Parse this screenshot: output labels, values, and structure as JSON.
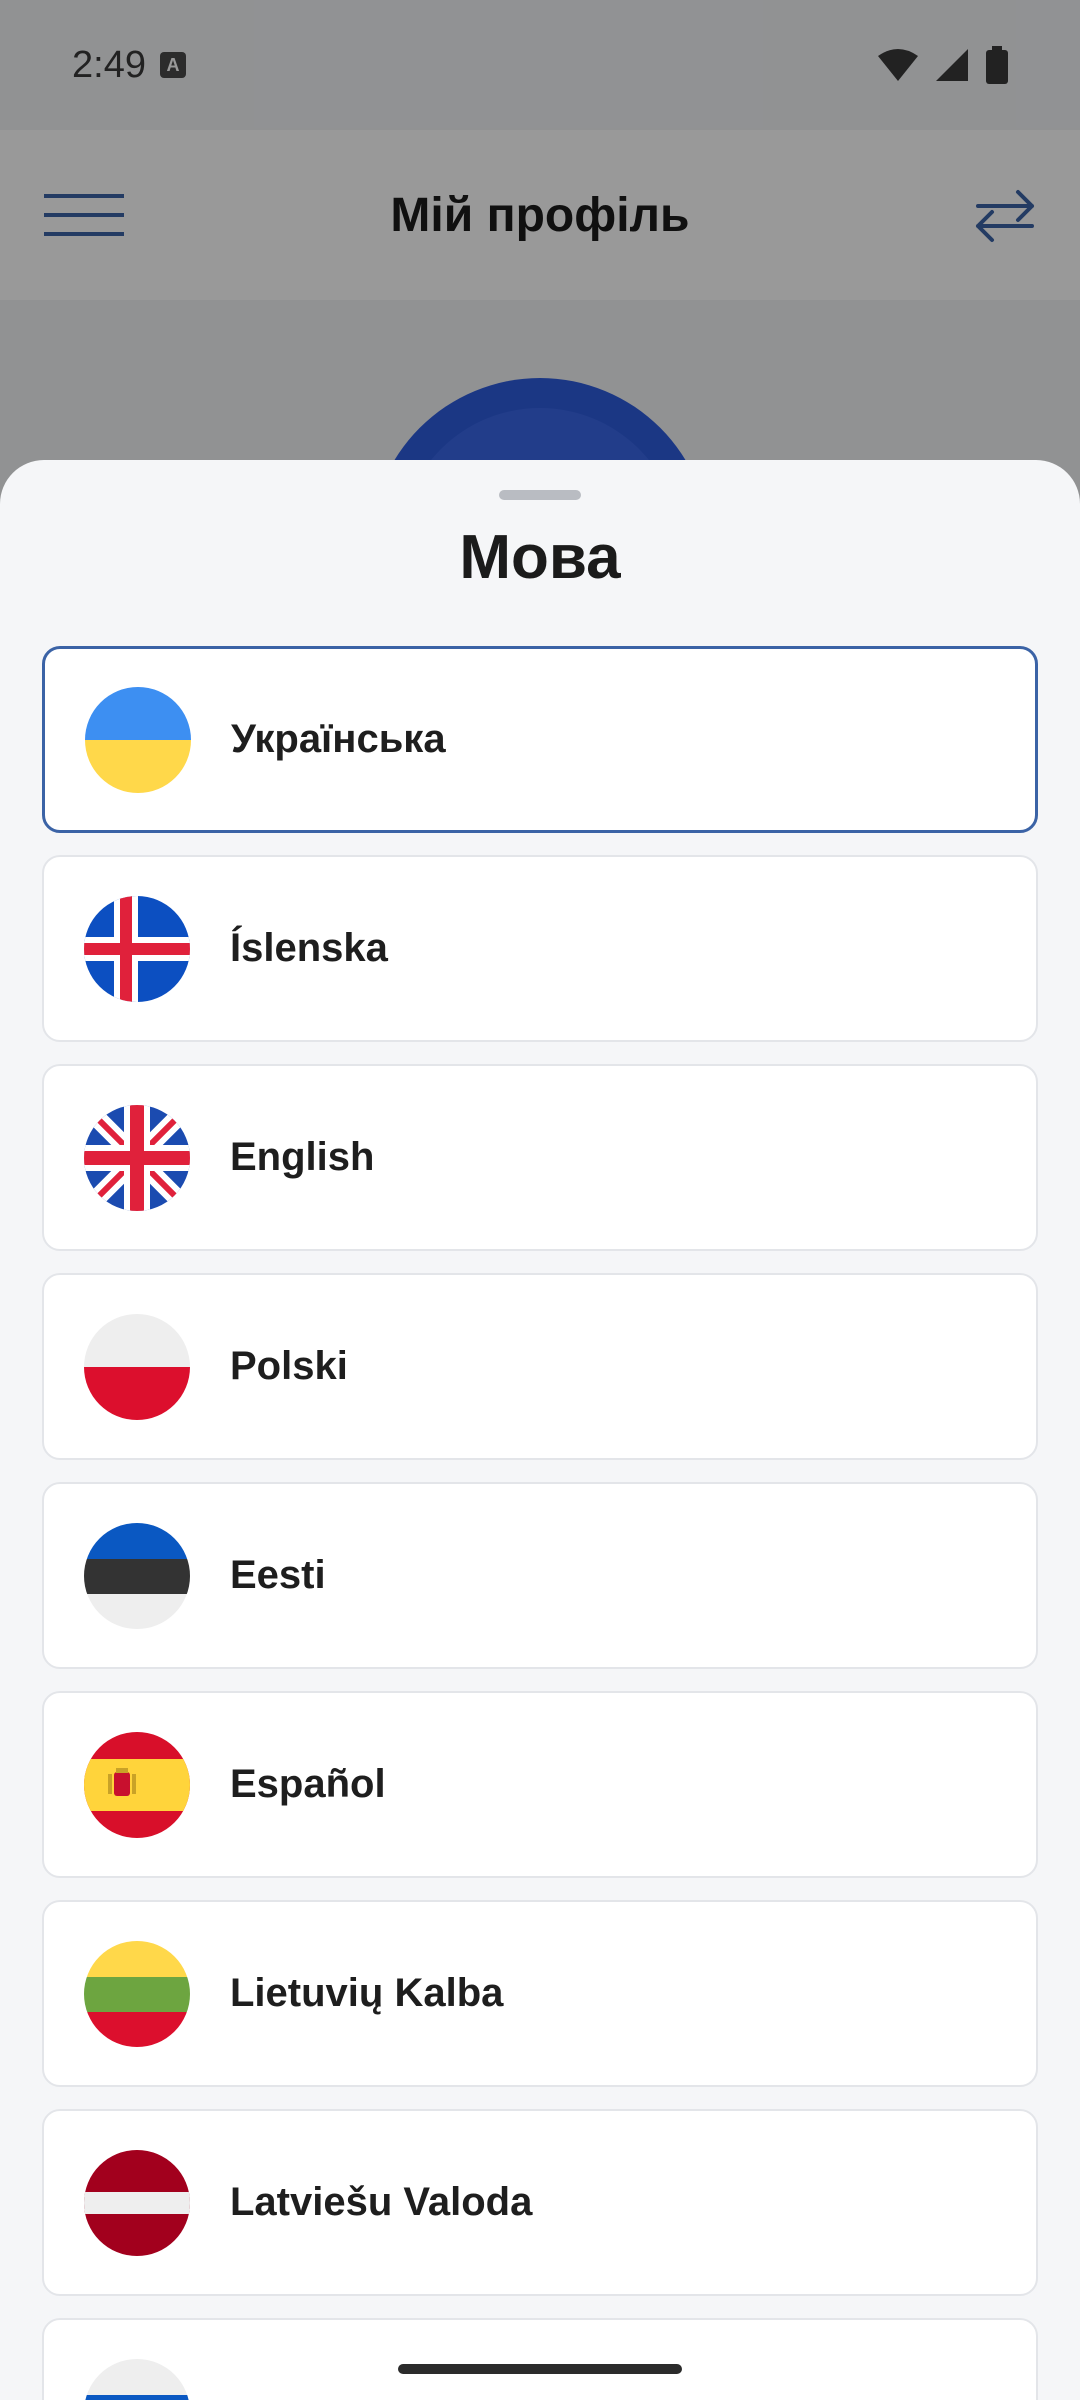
{
  "status_bar": {
    "time": "2:49",
    "badge": "A"
  },
  "app_bar": {
    "title": "Мій профіль"
  },
  "sheet": {
    "title": "Мова",
    "languages": [
      {
        "label": "Українська",
        "flag": "ukraine-flag-icon",
        "selected": true
      },
      {
        "label": "Íslenska",
        "flag": "iceland-flag-icon",
        "selected": false
      },
      {
        "label": "English",
        "flag": "uk-flag-icon",
        "selected": false
      },
      {
        "label": "Polski",
        "flag": "poland-flag-icon",
        "selected": false
      },
      {
        "label": "Eesti",
        "flag": "estonia-flag-icon",
        "selected": false
      },
      {
        "label": "Español",
        "flag": "spain-flag-icon",
        "selected": false
      },
      {
        "label": "Lietuvių Kalba",
        "flag": "lithuania-flag-icon",
        "selected": false
      },
      {
        "label": "Latviešu Valoda",
        "flag": "latvia-flag-icon",
        "selected": false
      },
      {
        "label": "",
        "flag": "russia-flag-icon",
        "selected": false
      }
    ]
  },
  "colors": {
    "accent": "#3b63a6",
    "avatar": "#2e5cdd",
    "selected_border": "#3b63a6"
  }
}
